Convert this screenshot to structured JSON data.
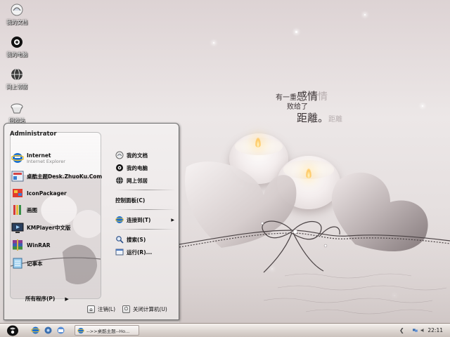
{
  "desktop": {
    "icons": [
      {
        "label": "我的文档",
        "icon": "my-documents-icon"
      },
      {
        "label": "我的电脑",
        "icon": "my-computer-icon"
      },
      {
        "label": "网上邻居",
        "icon": "network-places-icon"
      },
      {
        "label": "回收站",
        "icon": "recycle-bin-icon"
      }
    ]
  },
  "wallpaper": {
    "poem_line1_a": "有一重",
    "poem_line1_b": "感情",
    "poem_line2": "败给了",
    "poem_line3": "距離。",
    "ghost_1": "情",
    "ghost_2": "距離"
  },
  "start_menu": {
    "user": "Administrator",
    "programs": [
      {
        "label": "Internet",
        "sub": "Internet Explorer",
        "icon": "internet-explorer-icon"
      },
      {
        "label": "桌酷主题Desk.ZhuoKu.Com",
        "sub": "",
        "icon": "zhuoku-theme-icon"
      },
      {
        "label": "IconPackager",
        "sub": "",
        "icon": "iconpackager-icon"
      },
      {
        "label": "画图",
        "sub": "",
        "icon": "paint-icon"
      },
      {
        "label": "KMPlayer中文版",
        "sub": "",
        "icon": "kmplayer-icon"
      },
      {
        "label": "WinRAR",
        "sub": "",
        "icon": "winrar-icon"
      },
      {
        "label": "记事本",
        "sub": "",
        "icon": "notepad-icon"
      }
    ],
    "all_programs": "所有程序(P)",
    "places": [
      {
        "label": "我的文档",
        "icon": "my-documents-icon"
      },
      {
        "label": "我的电脑",
        "icon": "my-computer-icon"
      },
      {
        "label": "网上邻居",
        "icon": "network-places-icon"
      }
    ],
    "control_panel": "控制面板(C)",
    "connect_to": "连接到(T)",
    "search": "搜索(S)",
    "run": "运行(R)...",
    "logoff": "注销(L)",
    "shutdown": "关闭计算机(U)"
  },
  "taskbar": {
    "task_label": "-->>桌酷主题--Ho...",
    "clock": "22:11"
  },
  "colors": {
    "wallpaper_base": "#e6e0e0",
    "taskbar": "#dcd5d0",
    "ie_blue": "#1a6fd1"
  }
}
